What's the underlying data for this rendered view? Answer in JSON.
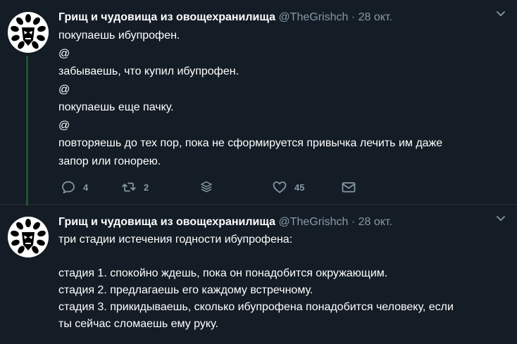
{
  "tweets": [
    {
      "author_name": "Грищ и чудовища из овощехранилища",
      "handle": "@TheGrishch",
      "separator": "·",
      "date": "28 окт.",
      "lines": [
        "покупаешь ибупрофен.",
        "@",
        "забываешь, что купил ибупрофен.",
        "@",
        "покупаешь еще пачку.",
        "@",
        "повторяешь до тех пор, пока не сформируется привычка лечить им даже",
        "запор или гонорею."
      ],
      "actions": {
        "replies": "4",
        "retweets": "2",
        "likes": "45"
      }
    },
    {
      "author_name": "Грищ и чудовища из овощехранилища",
      "handle": "@TheGrishch",
      "separator": "·",
      "date": "28 окт.",
      "lines": [
        "три стадии истечения годности ибупрофена:",
        "",
        "стадия 1. спокойно ждешь, пока он понадобится окружающим.",
        "стадия 2. предлагаешь его каждому встречному.",
        "стадия 3. прикидываешь, сколько ибупрофена понадобится человеку, если",
        "ты сейчас сломаешь ему руку."
      ]
    }
  ],
  "icons": {
    "reply": "reply-icon",
    "retweet": "retweet-icon",
    "stack": "stack-icon",
    "like": "heart-icon",
    "dm": "envelope-icon",
    "more": "chevron-down-icon"
  },
  "colors": {
    "background": "#141d26",
    "muted": "#8899a6",
    "thread_line": "#1f5132",
    "text": "#ffffff"
  }
}
